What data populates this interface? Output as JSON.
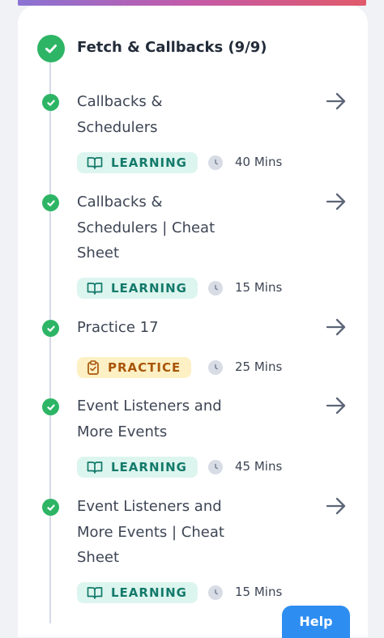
{
  "section": {
    "title": "Fetch & Callbacks (9/9)",
    "status_color": "#2db565"
  },
  "items": [
    {
      "title_lines": [
        "Callbacks &",
        "Schedulers"
      ],
      "badge": "LEARNING",
      "duration": "40 Mins",
      "type": "learning"
    },
    {
      "title_lines": [
        "Callbacks &",
        "Schedulers | Cheat",
        "Sheet"
      ],
      "badge": "LEARNING",
      "duration": "15 Mins",
      "type": "learning"
    },
    {
      "title_lines": [
        "Practice 17"
      ],
      "badge": "PRACTICE",
      "duration": "25 Mins",
      "type": "practice"
    },
    {
      "title_lines": [
        "Event Listeners and",
        "More Events"
      ],
      "badge": "LEARNING",
      "duration": "45 Mins",
      "type": "learning"
    },
    {
      "title_lines": [
        "Event Listeners and",
        "More Events | Cheat",
        "Sheet"
      ],
      "badge": "LEARNING",
      "duration": "15 Mins",
      "type": "learning"
    }
  ],
  "icons": {
    "check": "check-icon",
    "arrow": "arrow-right-icon",
    "learning": "book-icon",
    "practice": "clipboard-icon",
    "clock": "clock-icon"
  },
  "colors": {
    "learning_bg": "#ddf5ef",
    "learning_text": "#137a6a",
    "practice_bg": "#fdf0c4",
    "practice_text": "#a8560a",
    "help_button": "#2d8df0"
  },
  "help": {
    "label": "Help"
  }
}
